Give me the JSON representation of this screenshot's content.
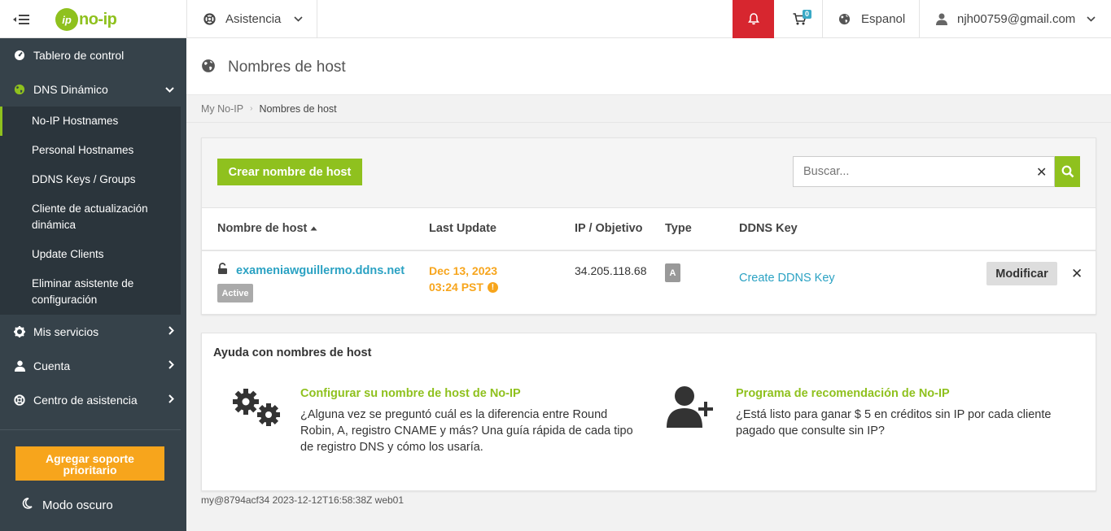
{
  "topbar": {
    "logo_text": "no-ip",
    "help_label": "Asistencia",
    "cart_count": "0",
    "language": "Espanol",
    "user_email": "njh00759@gmail.com"
  },
  "sidebar": {
    "items": [
      {
        "label": "Tablero de control",
        "icon": "dashboard-icon"
      },
      {
        "label": "DNS Dinámico",
        "icon": "globe-icon"
      },
      {
        "label": "Mis servicios",
        "icon": "gear-icon"
      },
      {
        "label": "Cuenta",
        "icon": "user-icon"
      },
      {
        "label": "Centro de asistencia",
        "icon": "lifebuoy-icon"
      }
    ],
    "subitems": [
      {
        "label": "No-IP Hostnames"
      },
      {
        "label": "Personal Hostnames"
      },
      {
        "label": "DDNS Keys / Groups"
      },
      {
        "label_line1": "Cliente de actualización",
        "label_line2": "dinámica"
      },
      {
        "label": "Update Clients"
      },
      {
        "label_line1": "Eliminar asistente de",
        "label_line2": "configuración"
      }
    ],
    "cta_line1": "Agregar soporte",
    "cta_line2": "prioritario",
    "dark_mode": "Modo oscuro"
  },
  "page": {
    "title": "Nombres de host",
    "breadcrumb_root": "My No-IP",
    "breadcrumb_current": "Nombres de host"
  },
  "hosts": {
    "create_button": "Crear nombre de host",
    "search_placeholder": "Buscar...",
    "columns": {
      "hostname": "Nombre de host",
      "last_update": "Last Update",
      "ip": "IP / Objetivo",
      "type": "Type",
      "ddns": "DDNS Key"
    },
    "rows": [
      {
        "hostname": "exameniawguillermo.ddns.net",
        "status": "Active",
        "date": "Dec 13, 2023",
        "time": "03:24 PST",
        "ip": "34.205.118.68",
        "type": "A",
        "ddns_action": "Create DDNS Key",
        "modify": "Modificar"
      }
    ]
  },
  "help": {
    "title": "Ayuda con nombres de host",
    "card1_title": "Configurar su nombre de host de No-IP",
    "card1_text": "¿Alguna vez se preguntó cuál es la diferencia entre Round Robin, A, registro CNAME y más? Una guía rápida de cada tipo de registro DNS y cómo los usaría.",
    "card2_title": "Programa de recomendación de No-IP",
    "card2_text": "¿Está listo para ganar $ 5 en créditos sin IP por cada cliente pagado que consulte sin IP?"
  },
  "footer": "my@8794acf34 2023-12-12T16:58:38Z web01",
  "colors": {
    "brand_green": "#8fc11e",
    "sidebar_bg": "#36424a",
    "alert_red": "#d7262f",
    "link_blue": "#2ba2c3",
    "warning_orange": "#f7a51c"
  }
}
